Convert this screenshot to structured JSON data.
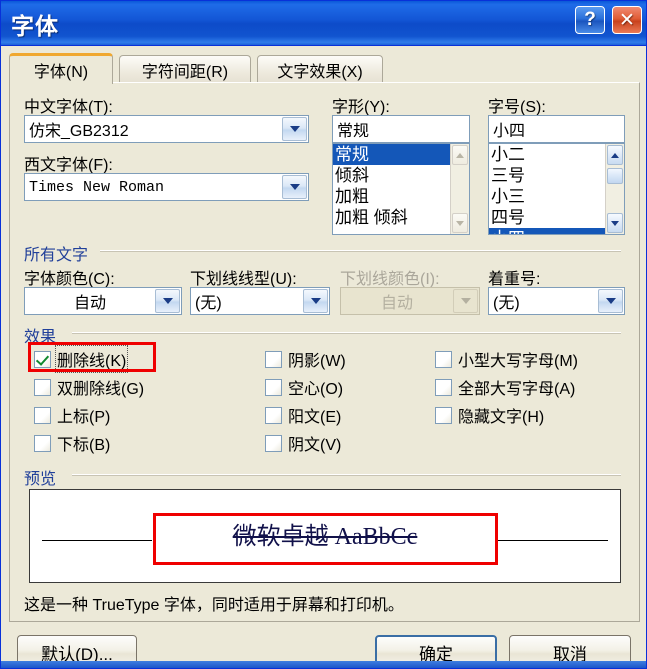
{
  "window": {
    "title": "字体",
    "help_button": "?",
    "close_button": "✕"
  },
  "tabs": [
    {
      "label": "字体(N)",
      "active": true
    },
    {
      "label": "字符间距(R)",
      "active": false
    },
    {
      "label": "文字效果(X)",
      "active": false
    }
  ],
  "font_section": {
    "chinese_font_label": "中文字体(T):",
    "chinese_font_value": "仿宋_GB2312",
    "western_font_label": "西文字体(F):",
    "western_font_value": "Times New Roman",
    "style_label": "字形(Y):",
    "style_value": "常规",
    "style_options": [
      "常规",
      "倾斜",
      "加粗",
      "加粗  倾斜"
    ],
    "style_selected_index": 0,
    "size_label": "字号(S):",
    "size_value": "小四",
    "size_options": [
      "小二",
      "三号",
      "小三",
      "四号",
      "小四"
    ],
    "size_selected_index": 4
  },
  "all_text_section": {
    "group_label": "所有文字",
    "font_color_label": "字体颜色(C):",
    "font_color_value": "自动",
    "underline_style_label": "下划线线型(U):",
    "underline_style_value": "(无)",
    "underline_color_label": "下划线颜色(I):",
    "underline_color_value": "自动",
    "underline_color_disabled": true,
    "emphasis_label": "着重号:",
    "emphasis_value": "(无)"
  },
  "effects_section": {
    "group_label": "效果",
    "column1": [
      {
        "label": "删除线(K)",
        "checked": true,
        "focused": true,
        "highlighted": true
      },
      {
        "label": "双删除线(G)",
        "checked": false,
        "focused": false,
        "highlighted": false
      },
      {
        "label": "上标(P)",
        "checked": false,
        "focused": false,
        "highlighted": false
      },
      {
        "label": "下标(B)",
        "checked": false,
        "focused": false,
        "highlighted": false
      }
    ],
    "column2": [
      {
        "label": "阴影(W)",
        "checked": false
      },
      {
        "label": "空心(O)",
        "checked": false
      },
      {
        "label": "阳文(E)",
        "checked": false
      },
      {
        "label": "阴文(V)",
        "checked": false
      }
    ],
    "column3": [
      {
        "label": "小型大写字母(M)",
        "checked": false
      },
      {
        "label": "全部大写字母(A)",
        "checked": false
      },
      {
        "label": "隐藏文字(H)",
        "checked": false
      }
    ]
  },
  "preview_section": {
    "group_label": "预览",
    "sample_text": "微软卓越  AaBbCc",
    "sample_strikethrough": true,
    "highlighted": true
  },
  "description": "这是一种 TrueType 字体，同时适用于屏幕和打印机。",
  "footer": {
    "default_button": "默认(D)...",
    "ok_button": "确定",
    "cancel_button": "取消"
  },
  "colors": {
    "titlebar_blue": "#1356d6",
    "dialog_face": "#ece9d8",
    "group_label_blue": "#21409a",
    "selection_blue": "#1457b8",
    "highlight_red": "#ef0000",
    "active_tab_accent": "#f0a830",
    "check_green": "#128a2e"
  }
}
